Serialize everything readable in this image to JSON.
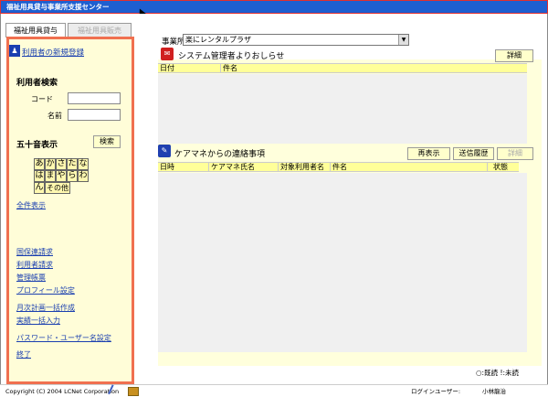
{
  "window": {
    "title": "福祉用具貸与事業所支援センター"
  },
  "left": {
    "tabs": [
      {
        "label": "福祉用具貸与",
        "active": true
      },
      {
        "label": "福祉用具販売",
        "active": false
      }
    ],
    "new_user_link": "利用者の新規登録",
    "search_heading": "利用者検索",
    "code_label": "コード",
    "name_label": "名前",
    "gojuon_heading": "五十音表示",
    "search_button": "検索",
    "kana": [
      "あ",
      "か",
      "さ",
      "た",
      "な",
      "は",
      "ま",
      "や",
      "ら",
      "わ",
      "ん"
    ],
    "kana_other": "その他",
    "show_all": "全件表示",
    "links": [
      "国保連請求",
      "利用者請求",
      "管理帳票",
      "プロフィール設定",
      "月次計画一括作成",
      "実績一括入力",
      "パスワード・ユーザー名設定",
      "終了"
    ]
  },
  "top": {
    "office_label": "事業所",
    "office_value": "楽にレンタルプラザ"
  },
  "system_notice": {
    "title": "システム管理者よりおしらせ",
    "detail_button": "詳細",
    "columns": [
      "日付",
      "件名"
    ]
  },
  "caremanager": {
    "title": "ケアマネからの連絡事項",
    "buttons": {
      "refresh": "再表示",
      "history": "送信履歴",
      "detail": "詳細"
    },
    "columns": [
      "日時",
      "ケアマネ氏名",
      "対象利用者名",
      "件名",
      "状態"
    ]
  },
  "legend": "○:既読 !:未読",
  "status": {
    "copyright": "Copyright (C) 2004 LCNet Corporation",
    "login_label": "ログインユーザー:",
    "user_name": "小林龍治"
  },
  "colors": {
    "accent": "#f07050",
    "panel": "#ffffdc",
    "link": "#1a3fb0"
  }
}
